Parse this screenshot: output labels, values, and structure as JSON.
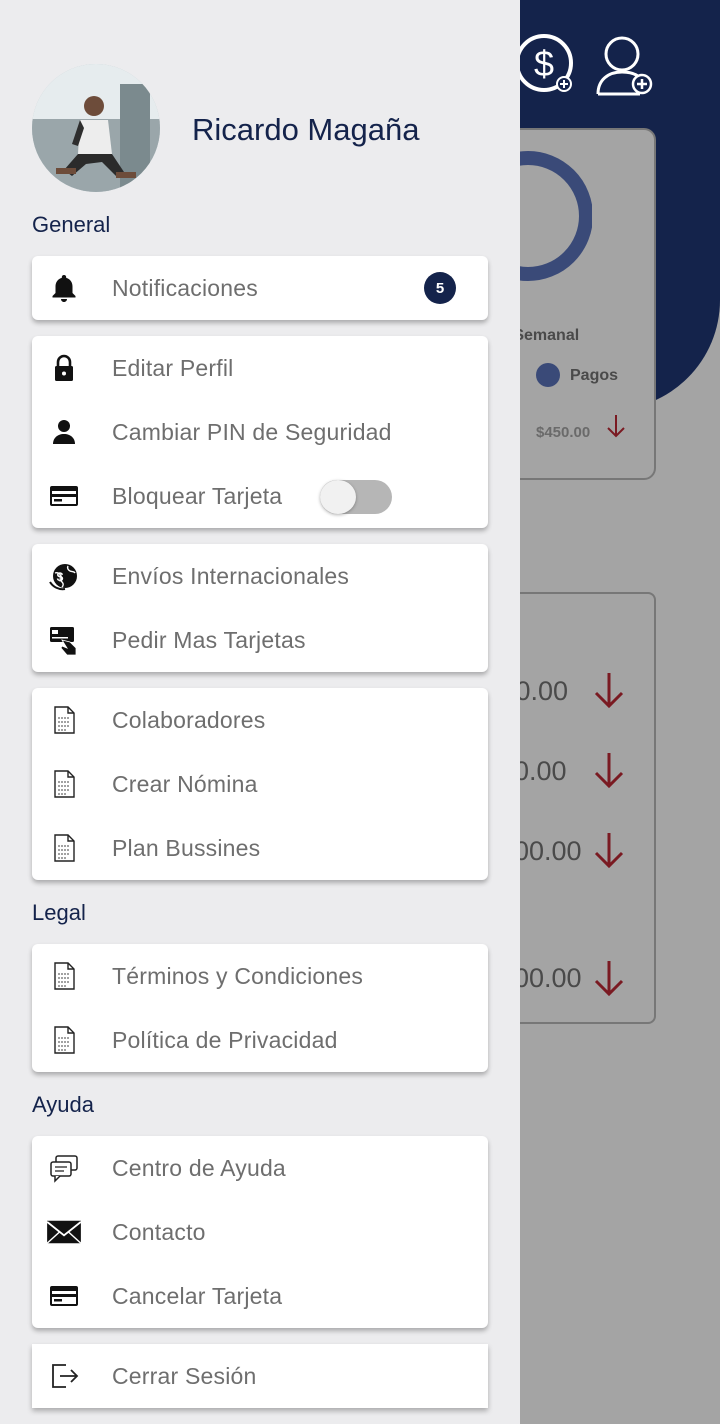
{
  "background": {
    "weekly_label": "e Semanal",
    "legend_label": "Pagos",
    "amount": "$450.00",
    "rows": [
      ".0.00",
      "0.00",
      "00.00",
      "00.00"
    ],
    "colors": {
      "header": "#14234b",
      "arrow": "#7a1a22",
      "donut": "#3a4a78"
    }
  },
  "drawer": {
    "user": {
      "name": "Ricardo Magaña"
    },
    "sections": {
      "general": "General",
      "legal": "Legal",
      "help": "Ayuda"
    },
    "general_card": {
      "notifications_label": "Notificaciones",
      "notifications_count": "5"
    },
    "account_card": [
      {
        "label": "Editar Perfil",
        "icon": "lock-icon"
      },
      {
        "label": "Cambiar PIN de Seguridad",
        "icon": "person-icon"
      },
      {
        "label": "Bloquear Tarjeta",
        "icon": "credit-card-icon",
        "toggle_on": false
      }
    ],
    "transfer_card": [
      {
        "label": "Envíos Internacionales",
        "icon": "globe-money-icon"
      },
      {
        "label": "Pedir Mas Tarjetas",
        "icon": "card-hand-icon"
      }
    ],
    "business_card": [
      {
        "label": "Colaboradores",
        "icon": "document-icon"
      },
      {
        "label": "Crear Nómina",
        "icon": "document-icon"
      },
      {
        "label": "Plan Bussines",
        "icon": "document-icon"
      }
    ],
    "legal_card": [
      {
        "label": "Términos y Condiciones",
        "icon": "document-icon"
      },
      {
        "label": "Política de Privacidad",
        "icon": "document-icon"
      }
    ],
    "help_card": [
      {
        "label": "Centro de Ayuda",
        "icon": "chat-icon"
      },
      {
        "label": "Contacto",
        "icon": "envelope-icon"
      },
      {
        "label": "Cancelar Tarjeta",
        "icon": "credit-card-icon"
      }
    ],
    "logout_label": "Cerrar Sesión"
  }
}
